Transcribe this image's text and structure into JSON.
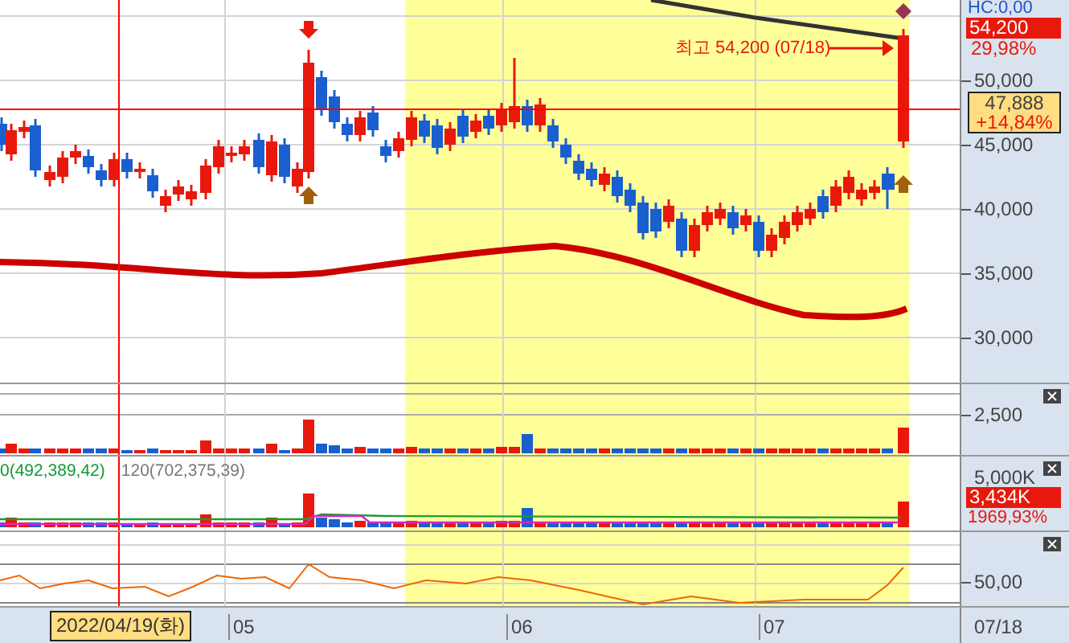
{
  "price_axis": {
    "top_label": "HC:0,00",
    "labels": [
      "50,000",
      "45,000",
      "40,000",
      "35,000",
      "30,000"
    ]
  },
  "high_marker": {
    "text": "최고 54,200 (07/18)"
  },
  "last_high": {
    "price": "54,200",
    "change": "29,98%"
  },
  "current": {
    "price": "47,888",
    "change": "+14,84%"
  },
  "volume_panel": {
    "axis_label": "2,500"
  },
  "indicator_panel": {
    "legend": [
      {
        "text": "0(492,389,42)",
        "color": "#119933"
      },
      {
        "text": "120(702,375,39)",
        "color": "#777777"
      }
    ],
    "axis_label": "5,000K",
    "value": "3,434K",
    "percent": "1969,93%"
  },
  "oscillator_panel": {
    "axis_label": "50,00"
  },
  "date_axis": {
    "cursor_date": "2022/04/19(화)",
    "months": [
      "05",
      "06",
      "07"
    ],
    "last_date": "07/18"
  }
}
